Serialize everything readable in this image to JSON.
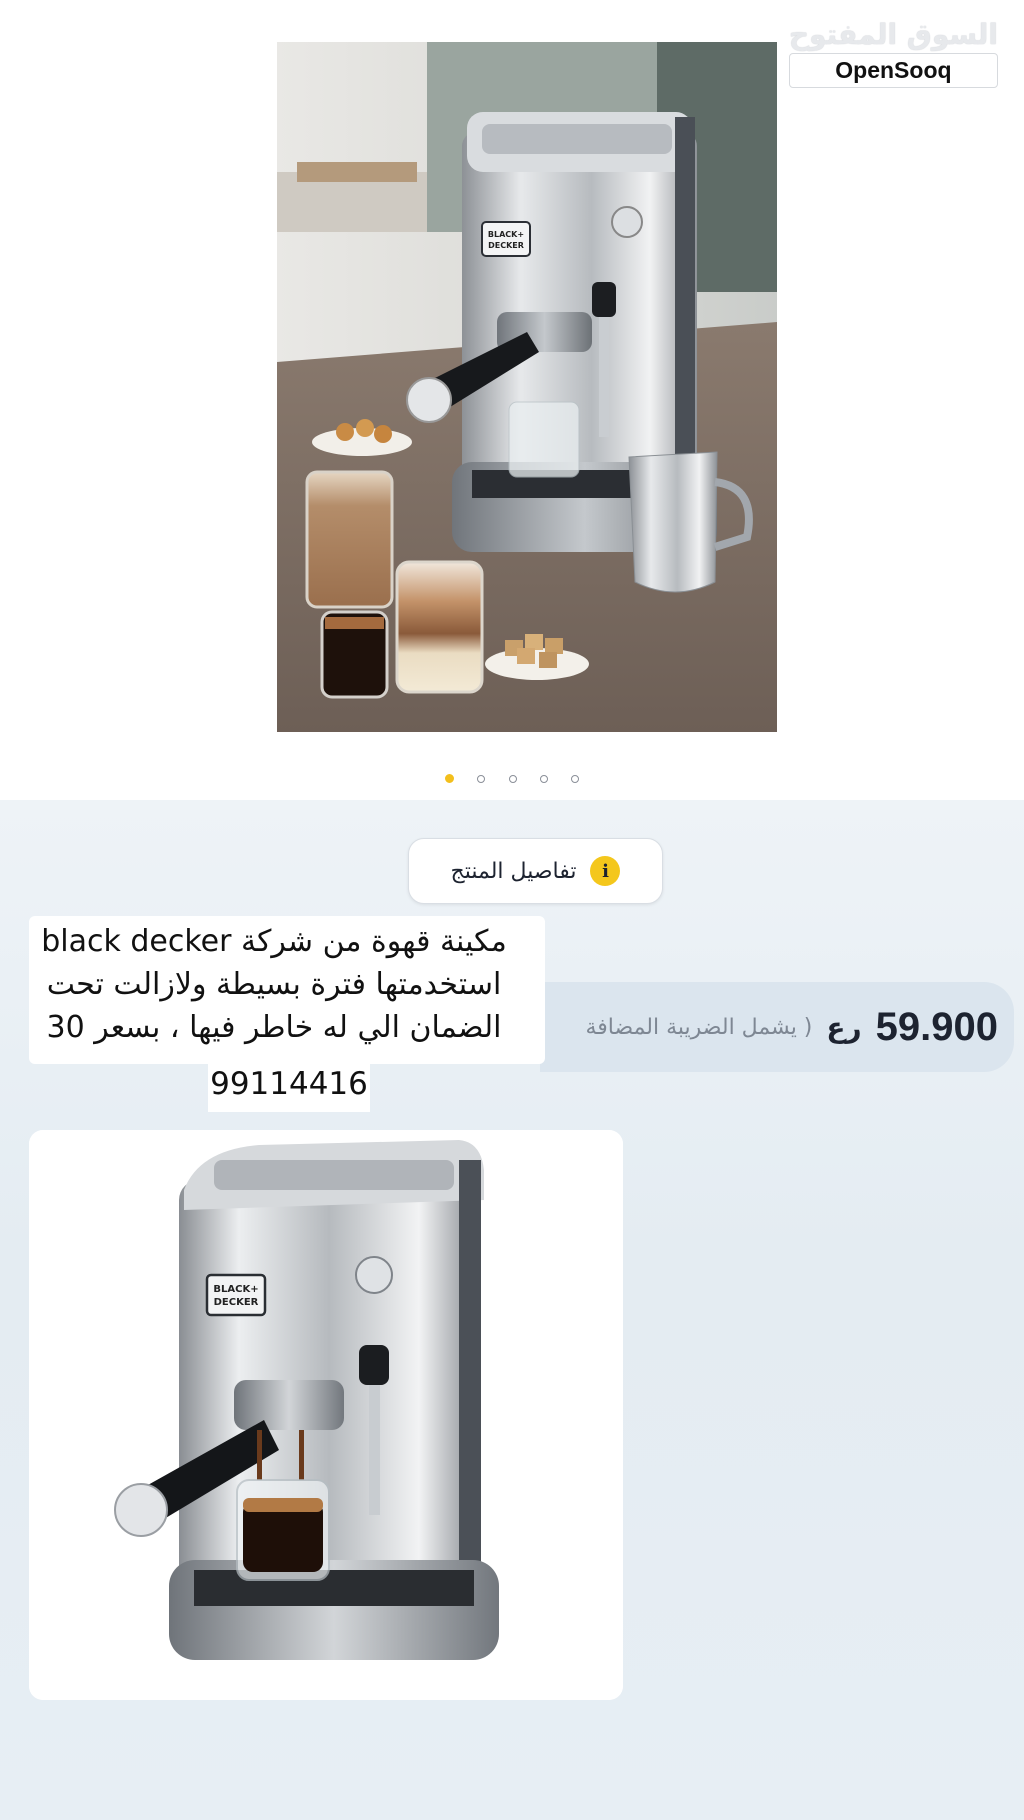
{
  "watermark": {
    "arabic": "السوق المفتوح",
    "english": "OpenSooq"
  },
  "gallery": {
    "image_count": 5,
    "active_index": 0
  },
  "details_button": {
    "label": "تفاصيل المنتج",
    "icon": "info-icon"
  },
  "price": {
    "value": "59.900",
    "currency": "رع",
    "vat_note": "( يشمل الضريبة المضافة"
  },
  "caption": {
    "line1": "مكينة قهوة من شركة black decker",
    "line2": "استخدمتها فترة بسيطة ولازالت تحت",
    "line3": "الضمان الي له خاطر فيها ، بسعر 30",
    "phone": "99114416"
  },
  "machine_label": "BLACK+\nDECKER",
  "colors": {
    "accent_yellow": "#f3bf1c",
    "text_dark": "#1d2330",
    "price_bar": "#dbe5ee"
  }
}
